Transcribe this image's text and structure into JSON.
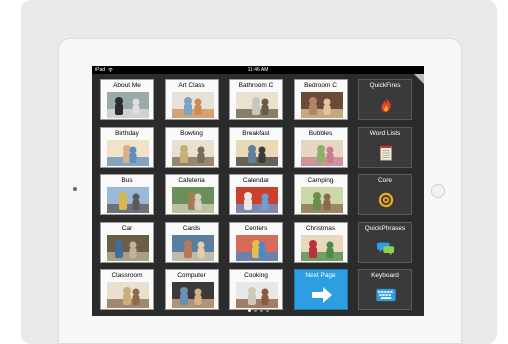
{
  "status": {
    "device": "iPad",
    "time": "11:46 AM"
  },
  "tiles": [
    {
      "label": "About Me",
      "row": 0,
      "col": 0,
      "kind": "photo",
      "colors": [
        "#2b2b2b",
        "#ddd",
        "#9aa"
      ]
    },
    {
      "label": "Art Class",
      "row": 0,
      "col": 1,
      "kind": "photo",
      "colors": [
        "#7aa3c4",
        "#c98d55",
        "#e7e2d5"
      ]
    },
    {
      "label": "Bathroom C",
      "row": 0,
      "col": 2,
      "kind": "photo",
      "colors": [
        "#c8c6bf",
        "#6b5b49",
        "#e8e2cf"
      ]
    },
    {
      "label": "Bedroom C",
      "row": 0,
      "col": 3,
      "kind": "photo",
      "colors": [
        "#b28465",
        "#e3c59b",
        "#6b4b35"
      ]
    },
    {
      "label": "QuickFires",
      "row": 0,
      "col": 4,
      "kind": "dark",
      "icon": "fire-icon"
    },
    {
      "label": "Birthday",
      "row": 1,
      "col": 0,
      "kind": "photo",
      "colors": [
        "#d9b08c",
        "#5b8fc0",
        "#f2e3c7"
      ]
    },
    {
      "label": "Bowling",
      "row": 1,
      "col": 1,
      "kind": "photo",
      "colors": [
        "#c9b07a",
        "#7b6a55",
        "#e8e0d0"
      ]
    },
    {
      "label": "Breakfast",
      "row": 1,
      "col": 2,
      "kind": "photo",
      "colors": [
        "#5e7f9e",
        "#3a3a3a",
        "#e9d9b5"
      ]
    },
    {
      "label": "Bubbles",
      "row": 1,
      "col": 3,
      "kind": "photo",
      "colors": [
        "#8fb06a",
        "#c77d8f",
        "#e6d5c0"
      ]
    },
    {
      "label": "Word Lists",
      "row": 1,
      "col": 4,
      "kind": "dark",
      "icon": "notepad-icon"
    },
    {
      "label": "Bus",
      "row": 2,
      "col": 0,
      "kind": "photo",
      "colors": [
        "#d8b84a",
        "#5a5a5a",
        "#9bb9d6"
      ]
    },
    {
      "label": "Cafeteria",
      "row": 2,
      "col": 1,
      "kind": "photo",
      "colors": [
        "#a47d55",
        "#d8d0bc",
        "#6b8e5a"
      ]
    },
    {
      "label": "Calendar",
      "row": 2,
      "col": 2,
      "kind": "photo",
      "colors": [
        "#e8e8e8",
        "#6aa0d8",
        "#c9402f"
      ]
    },
    {
      "label": "Camping",
      "row": 2,
      "col": 3,
      "kind": "photo",
      "colors": [
        "#6a8f4a",
        "#8a6a4a",
        "#cbd9a8"
      ]
    },
    {
      "label": "Core",
      "row": 2,
      "col": 4,
      "kind": "dark",
      "icon": "target-icon"
    },
    {
      "label": "Car",
      "row": 3,
      "col": 0,
      "kind": "photo",
      "colors": [
        "#3e6f9a",
        "#c2b39a",
        "#6d5c4a"
      ]
    },
    {
      "label": "Cards",
      "row": 3,
      "col": 1,
      "kind": "photo",
      "colors": [
        "#b9765a",
        "#e1cfae",
        "#5a7ea0"
      ]
    },
    {
      "label": "Centers",
      "row": 3,
      "col": 2,
      "kind": "photo",
      "colors": [
        "#e0c04a",
        "#4a8ac9",
        "#d86a5a"
      ]
    },
    {
      "label": "Christmas",
      "row": 3,
      "col": 3,
      "kind": "photo",
      "colors": [
        "#b8323a",
        "#4a8a4a",
        "#e8d8c0"
      ]
    },
    {
      "label": "QuickPhrases",
      "row": 3,
      "col": 4,
      "kind": "dark",
      "icon": "speech-bubbles-icon"
    },
    {
      "label": "Classroom",
      "row": 4,
      "col": 0,
      "kind": "photo",
      "colors": [
        "#c9b07a",
        "#8a6a4a",
        "#e8e0d0"
      ]
    },
    {
      "label": "Computer",
      "row": 4,
      "col": 1,
      "kind": "photo",
      "colors": [
        "#6a8fb8",
        "#d6b28a",
        "#3a3a3a"
      ]
    },
    {
      "label": "Cooking",
      "row": 4,
      "col": 2,
      "kind": "photo",
      "colors": [
        "#d0c8b8",
        "#8a5a3a",
        "#e8e8e8"
      ]
    },
    {
      "label": "Next Page",
      "row": 4,
      "col": 3,
      "kind": "blue",
      "icon": "arrow-right-icon"
    },
    {
      "label": "Keyboard",
      "row": 4,
      "col": 4,
      "kind": "dark",
      "icon": "keyboard-icon"
    }
  ],
  "pager": {
    "count": 4,
    "active": 0
  },
  "colors": {
    "screen_bg": "#2b2b2b",
    "accent_blue": "#2d9ee0",
    "dark_tile": "#3a3a3a",
    "core_orange": "#f0a81e"
  }
}
